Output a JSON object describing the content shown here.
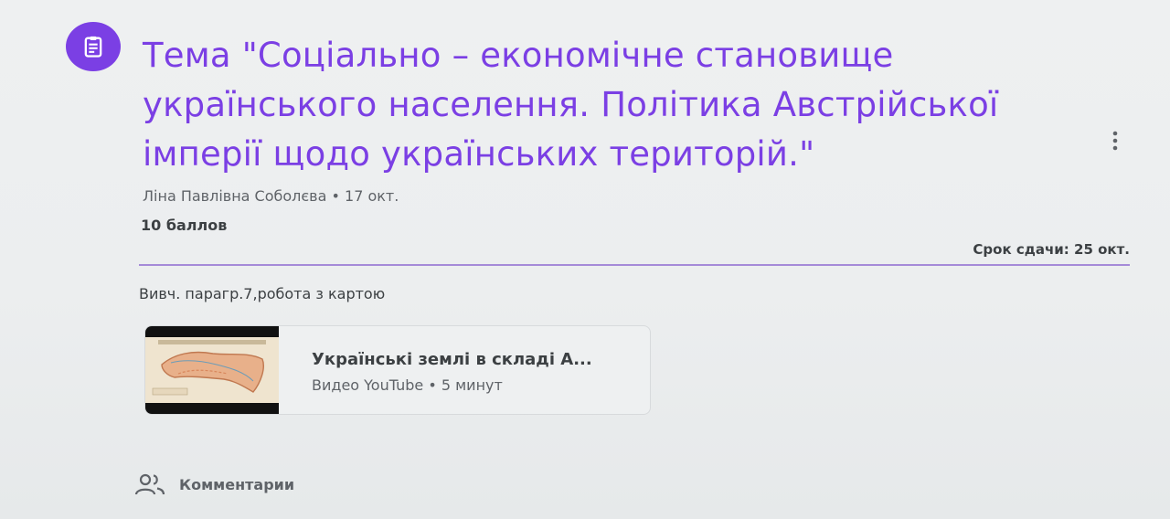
{
  "assignment": {
    "icon": "assignment-icon",
    "title": "Тема \"Соціально – економічне становище українського населення. Політика Австрійської імперії щодо українських територій.\"",
    "author": "Ліна Павлівна Соболєва",
    "separator": "•",
    "date": "17 окт.",
    "points": "10 баллов",
    "due": "Срок сдачи: 25 окт.",
    "instructions": "Вивч. парагр.7,робота з картою",
    "accent_color": "#7b3fe4"
  },
  "attachment": {
    "title": "Українські землі в складі А...",
    "type": "Видео YouTube",
    "separator": "•",
    "duration": "5 минут"
  },
  "comments": {
    "icon": "people-icon",
    "label": "Комментарии"
  },
  "menu": {
    "icon": "more-vert-icon"
  }
}
